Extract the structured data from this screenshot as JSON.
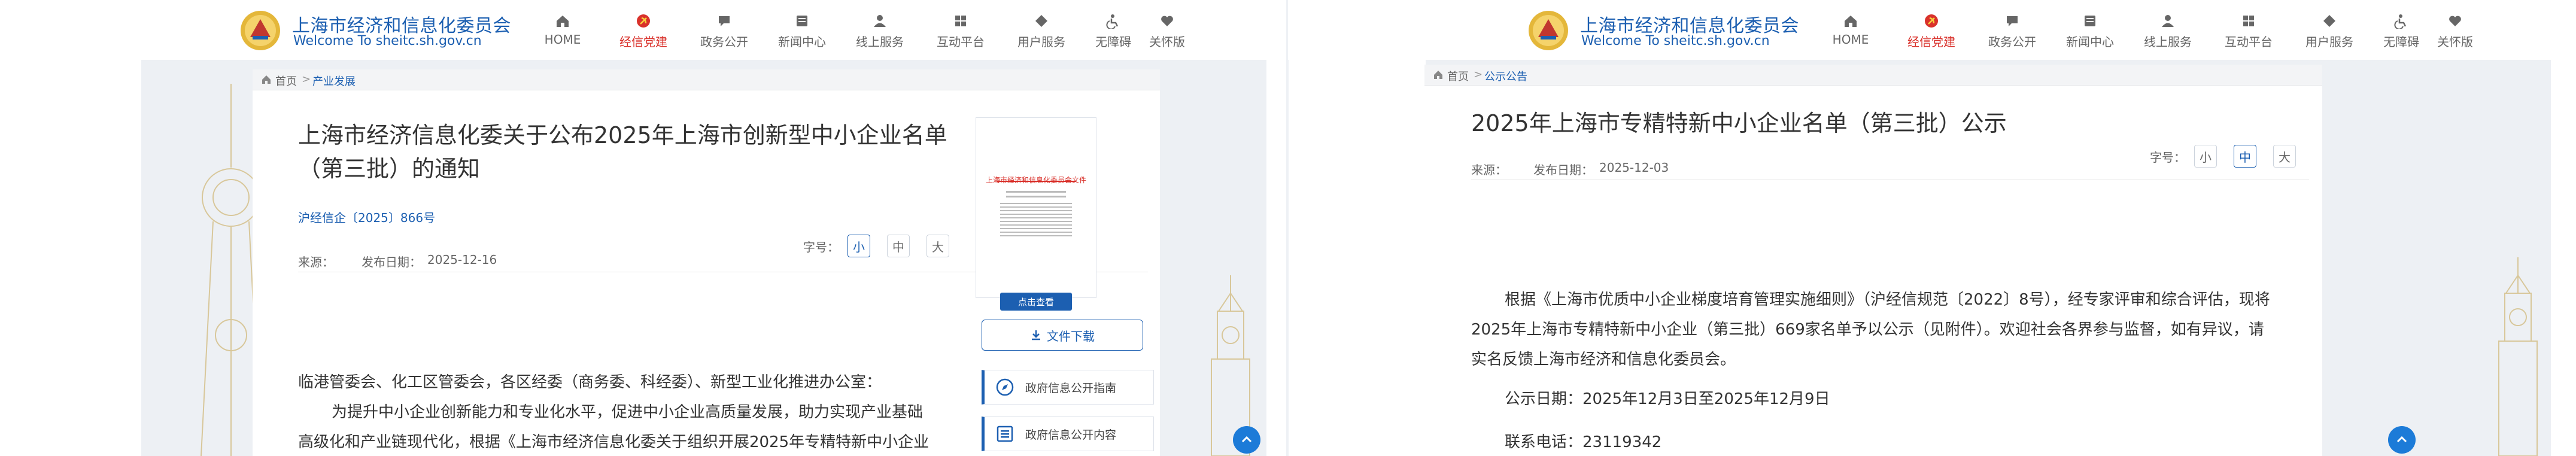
{
  "site": {
    "name_cn": "上海市经济和信息化委员会",
    "welcome_en": "Welcome To sheitc.sh.gov.cn"
  },
  "nav": {
    "items": [
      {
        "label": "HOME",
        "icon": "home-icon"
      },
      {
        "label": "经信党建",
        "icon": "party-emblem-icon"
      },
      {
        "label": "政务公开",
        "icon": "chat-bubble-icon"
      },
      {
        "label": "新闻中心",
        "icon": "news-icon"
      },
      {
        "label": "线上服务",
        "icon": "person-service-icon"
      },
      {
        "label": "互动平台",
        "icon": "grid-icon"
      },
      {
        "label": "用户服务",
        "icon": "diamond-icon"
      },
      {
        "label": "无障碍",
        "icon": "accessibility-icon"
      },
      {
        "label": "关怀版",
        "icon": "heart-care-icon"
      }
    ],
    "active_index": 1
  },
  "colors": {
    "brand": "#1c5fb1",
    "active": "#d9312b",
    "accent": "#1c7bd8"
  },
  "left": {
    "breadcrumb": {
      "home": "首页",
      "section": "产业发展"
    },
    "title_line1": "上海市经济信息化委关于公布2025年上海市创新型中小企业名单",
    "title_line2": "（第三批）的通知",
    "doc_number": "沪经信企〔2025〕866号",
    "source_label": "来源：",
    "date_label": "发布日期：",
    "date": "2025-12-16",
    "font_size_label": "字号：",
    "font_small": "小",
    "font_medium": "中",
    "font_large": "大",
    "salutation": "临港管委会、化工区管委会，各区经委（商务委、科经委）、新型工业化推进办公室：",
    "paragraph_visible": "为提升中小企业创新能力和专业化水平，促进中小企业高质量发展，助力实现产业基础",
    "paragraph_cut": "高级化和产业链现代化，根据《上海市经济信息化委关于组织开展2025年专精特新中小企业",
    "doc_thumb_header": "上海市经济和信息化委员会文件",
    "view_button": "点击查看",
    "download_button": "文件下载",
    "services": [
      {
        "label": "政府信息公开指南",
        "icon": "compass-icon"
      },
      {
        "label": "政府信息公开内容",
        "icon": "list-document-icon"
      }
    ]
  },
  "right": {
    "breadcrumb": {
      "home": "首页",
      "section": "公示公告"
    },
    "title": "2025年上海市专精特新中小企业名单（第三批）公示",
    "source_label": "来源：",
    "date_label": "发布日期：",
    "date": "2025-12-03",
    "font_size_label": "字号：",
    "font_small": "小",
    "font_medium": "中",
    "font_large": "大",
    "para_line1": "根据《上海市优质中小企业梯度培育管理实施细则》（沪经信规范〔2022〕8号），经专家评审和综合评估，现将",
    "para_line2": "2025年上海市专精特新中小企业（第三批）669家名单予以公示（见附件）。欢迎社会各界参与监督，如有异议，请",
    "para_line3": "实名反馈上海市经济和信息化委员会。",
    "period": "公示日期：2025年12月3日至2025年12月9日",
    "phone": "联系电话：23119342"
  }
}
